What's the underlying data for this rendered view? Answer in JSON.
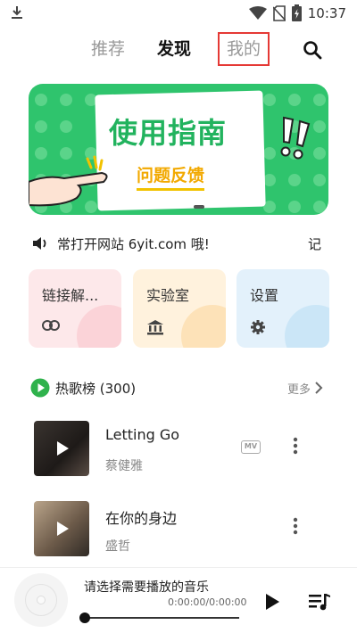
{
  "status_bar": {
    "time": "10:37",
    "icons": [
      "download-icon",
      "wifi-icon",
      "no-sim-icon",
      "battery-charging-icon"
    ]
  },
  "top_nav": {
    "tabs": [
      {
        "label": "推荐",
        "state": "inactive"
      },
      {
        "label": "发现",
        "state": "active"
      },
      {
        "label": "我的",
        "state": "highlighted"
      }
    ],
    "search_icon": "search-icon"
  },
  "banner": {
    "title": "使用指南",
    "subtitle": "问题反馈"
  },
  "notice": {
    "icon": "speaker-icon",
    "text": "常打开网站 6yit.com 哦!",
    "tail": "记"
  },
  "cards": [
    {
      "label": "链接解...",
      "icon": "link-icon",
      "color": "#fde8ea"
    },
    {
      "label": "实验室",
      "icon": "bank-icon",
      "color": "#fff2dd"
    },
    {
      "label": "设置",
      "icon": "gear-icon",
      "color": "#e3f1fb"
    }
  ],
  "hot_section": {
    "title": "热歌榜 (300)",
    "more": "更多",
    "accent": "#2fb24c",
    "songs": [
      {
        "name": "Letting Go",
        "artist": "蔡健雅",
        "mv": "MV"
      },
      {
        "name": "在你的身边",
        "artist": "盛哲"
      }
    ]
  },
  "player": {
    "prompt": "请选择需要播放的音乐",
    "time": "0:00:00/0:00:00",
    "progress": 0
  }
}
